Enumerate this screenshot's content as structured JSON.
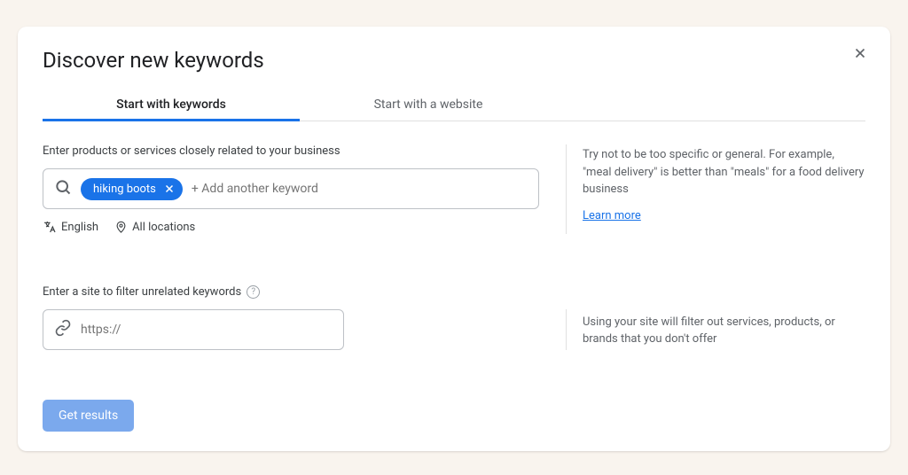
{
  "title": "Discover new keywords",
  "tabs": {
    "keywords": "Start with keywords",
    "website": "Start with a website"
  },
  "section1": {
    "label": "Enter products or services closely related to your business",
    "chip": "hiking boots",
    "placeholder": "+ Add another keyword",
    "meta": {
      "language": "English",
      "location": "All locations"
    },
    "hint": "Try not to be too specific or general. For example, \"meal delivery\" is better than \"meals\" for a food delivery business",
    "learn_more": "Learn more"
  },
  "section2": {
    "label": "Enter a site to filter unrelated keywords",
    "placeholder": "https://",
    "hint": "Using your site will filter out services, products, or brands that you don't offer"
  },
  "cta": "Get results"
}
